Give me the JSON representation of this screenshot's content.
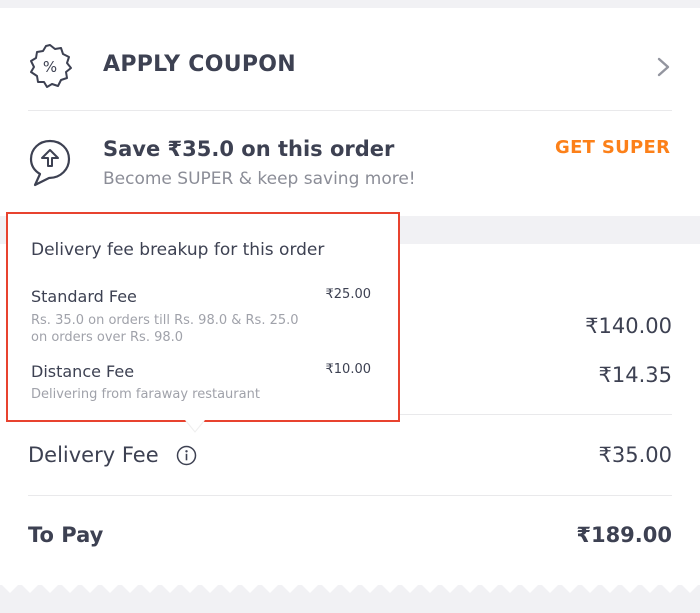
{
  "coupon": {
    "label": "APPLY COUPON",
    "icon": "coupon-percent-icon"
  },
  "super": {
    "title": "Save ₹35.0 on this order",
    "subtitle": "Become SUPER & keep saving more!",
    "cta": "GET SUPER",
    "icon": "super-badge-icon",
    "accent": "#fc8019"
  },
  "popup": {
    "title": "Delivery fee breakup for this order",
    "fees": [
      {
        "name": "Standard Fee",
        "amount": "₹25.00",
        "desc_line1": "Rs. 35.0 on orders till Rs. 98.0 & Rs. 25.0",
        "desc_line2": "on orders over Rs. 98.0"
      },
      {
        "name": "Distance Fee",
        "amount": "₹10.00",
        "desc_line1": "Delivering from faraway restaurant"
      }
    ],
    "border_color": "#e8432f"
  },
  "bill": {
    "item_total_value": "₹140.00",
    "taxes_value": "₹14.35",
    "delivery_fee_label": "Delivery Fee",
    "delivery_fee_value": "₹35.00",
    "to_pay_label": "To Pay",
    "to_pay_value": "₹189.00"
  }
}
